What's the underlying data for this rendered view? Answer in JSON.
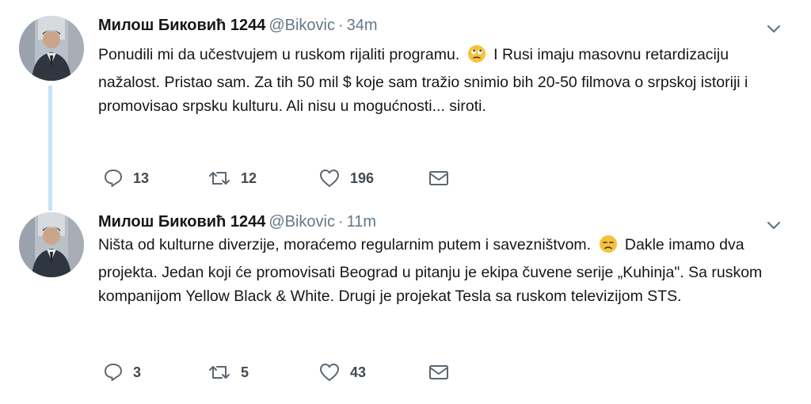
{
  "tweets": [
    {
      "author_name": "Милош Биковић 1244",
      "handle": "@Bikovic",
      "separator": "·",
      "time": "34m",
      "text_before_emoji": "Ponudili mi da učestvujem u ruskom rijaliti programu.",
      "emoji": "face-with-rolling-eyes-emoji",
      "text_after_emoji": "I Rusi imaju masovnu retardizaciju nažalost. Pristao sam. Za tih 50 mil $ koje sam tražio snimio bih 20-50 filmova o srpskoj istoriji i promovisao srpsku kulturu. Ali nisu u mogućnosti... siroti.",
      "replies": "13",
      "retweets": "12",
      "likes": "196"
    },
    {
      "author_name": "Милош Биковић 1244",
      "handle": "@Bikovic",
      "separator": "·",
      "time": "11m",
      "text_before_emoji": "Ništa od kulturne diverzije, moraćemo regularnim putem i savezništvom.",
      "emoji": "confused-face-emoji",
      "text_after_emoji": "Dakle imamo dva projekta. Jedan koji će promovisati Beograd u pitanju je ekipa čuvene serije „Kuhinja\". Sa ruskom kompanijom Yellow Black & White. Drugi je projekat Tesla sa ruskom televizijom STS.",
      "replies": "3",
      "retweets": "5",
      "likes": "43"
    }
  ],
  "icons": {
    "reply": "reply-icon",
    "retweet": "retweet-icon",
    "like": "heart-icon",
    "message": "envelope-icon",
    "menu": "chevron-down-icon"
  },
  "colors": {
    "text": "#14171a",
    "secondary": "#657786",
    "thread_line": "#c4e2f6",
    "action_icon": "#5c6670"
  }
}
